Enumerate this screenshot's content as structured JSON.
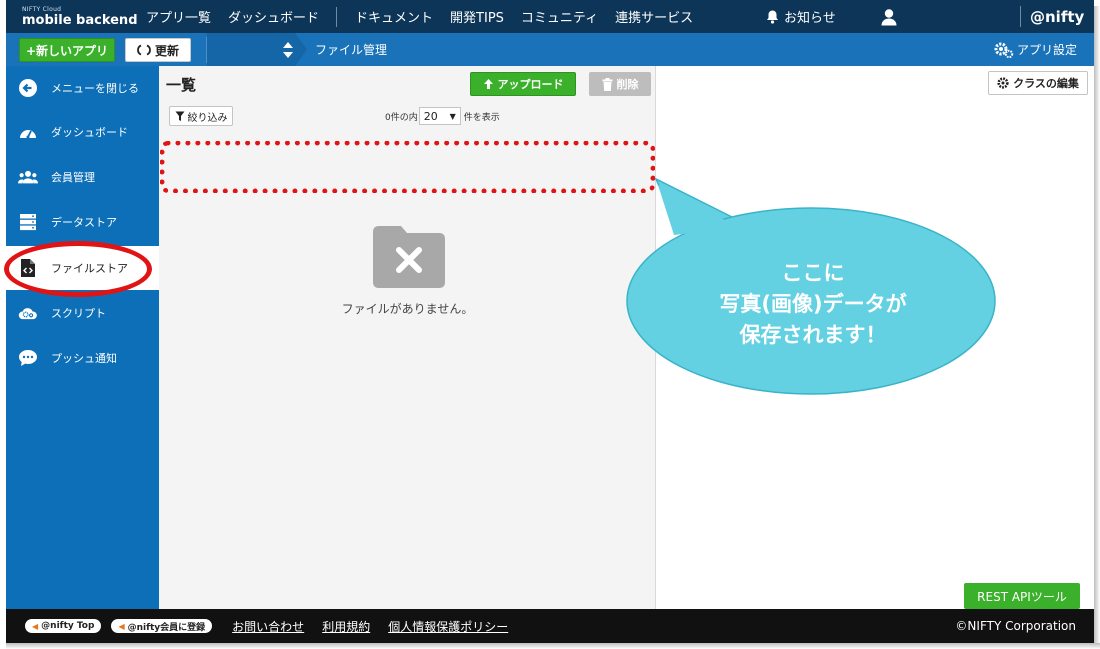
{
  "header": {
    "logo_small": "NIFTY Cloud",
    "logo_main": "mobile backend",
    "nav_primary": [
      "アプリ一覧",
      "ダッシュボード"
    ],
    "nav_secondary": [
      "ドキュメント",
      "開発TIPS",
      "コミュニティ",
      "連携サービス"
    ],
    "notice_label": "お知らせ",
    "brand": "@nifty"
  },
  "subbar": {
    "new_app_label": "+新しいアプリ",
    "refresh_label": "更新",
    "breadcrumb": "ファイル管理",
    "app_settings_label": "アプリ設定"
  },
  "sidebar": {
    "items": [
      {
        "label": "メニューを閉じる",
        "icon": "arrow-left-circle-icon"
      },
      {
        "label": "ダッシュボード",
        "icon": "gauge-icon"
      },
      {
        "label": "会員管理",
        "icon": "users-icon"
      },
      {
        "label": "データストア",
        "icon": "database-icon"
      },
      {
        "label": "ファイルストア",
        "icon": "file-code-icon",
        "active": true
      },
      {
        "label": "スクリプト",
        "icon": "cloud-gears-icon"
      },
      {
        "label": "プッシュ通知",
        "icon": "chat-bubble-icon"
      }
    ]
  },
  "main": {
    "title": "一覧",
    "upload_label": "アップロード",
    "delete_label": "削除",
    "filter_label": "絞り込み",
    "count_prefix": "0件の内",
    "page_size": "20",
    "count_suffix": "件を表示",
    "empty_message": "ファイルがありません。"
  },
  "right": {
    "class_edit_label": "クラスの編集",
    "rest_api_label": "REST APIツール"
  },
  "footer": {
    "badge_top": "@nifty Top",
    "badge_register": "@nifty会員に登録",
    "links": [
      "お問い合わせ",
      "利用規約",
      "個人情報保護ポリシー"
    ],
    "copyright": "©NIFTY Corporation"
  },
  "annotation": {
    "lines": [
      "ここに",
      "写真(画像)データが",
      "保存されます！"
    ]
  },
  "colors": {
    "topbar": "#0d3557",
    "subbar": "#1a73b8",
    "sidebar": "#0d6fb7",
    "green": "#3bb12b",
    "highlight_red": "#e01414",
    "bubble": "#64d1e3"
  }
}
